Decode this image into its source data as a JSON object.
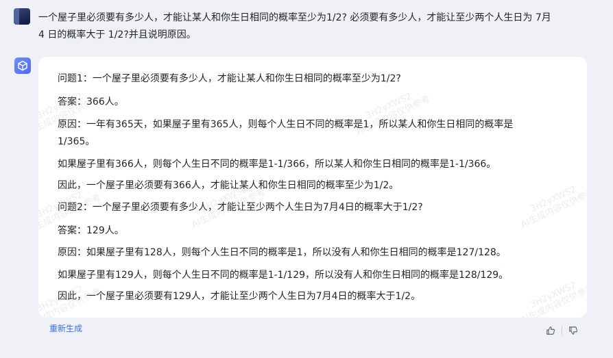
{
  "user": {
    "question_line1": "一个屋子里必须要有多少人，才能让某人和你生日相同的概率至少为1/2? 必须要有多少人，才能让至少两个人生日为 7月",
    "question_line2": "4 日的概率大于 1/2?并且说明原因。"
  },
  "answer": {
    "lines": [
      "问题1：一个屋子里必须要有多少人，才能让某人和你生日相同的概率至少为1/2?",
      "答案：366人。",
      "原因：一年有365天，如果屋子里有365人，则每个人生日不同的概率是1，所以某人和你生日相同的概率是",
      "1/365。",
      "如果屋子里有366人，则每个人生日不同的概率是1-1/366，所以某人和你生日相同的概率是1-1/366。",
      "因此，一个屋子里必须要有366人，才能让某人和你生日相同的概率至少为1/2。",
      "问题2：一个屋子里必须要有多少人，才能让至少两个人生日为7月4日的概率大于1/2?",
      "答案：129人。",
      "原因：如果屋子里有128人，则每个人生日不同的概率是1，所以没有人和你生日相同的概率是127/128。",
      "如果屋子里有129人，则每个人生日不同的概率是1-1/129，所以没有人和你生日相同的概率是128/129。",
      "因此，一个屋子里必须要有129人，才能让至少两个人生日为7月4日的概率大于1/2。"
    ],
    "watermark_code": "3H2yXWS2",
    "watermark_note": "AI生成内容仅供参考"
  },
  "actions": {
    "regenerate_label": "重新生成"
  },
  "icons": {
    "user_avatar": "user-avatar-image",
    "bot_avatar": "cube-logo-icon",
    "like": "thumbs-up-icon",
    "dislike": "thumbs-down-icon"
  },
  "colors": {
    "background": "#f0f1f6",
    "card": "#ffffff",
    "text": "#1f2329",
    "link": "#3370ff",
    "bot_avatar": "#5b78f6"
  }
}
